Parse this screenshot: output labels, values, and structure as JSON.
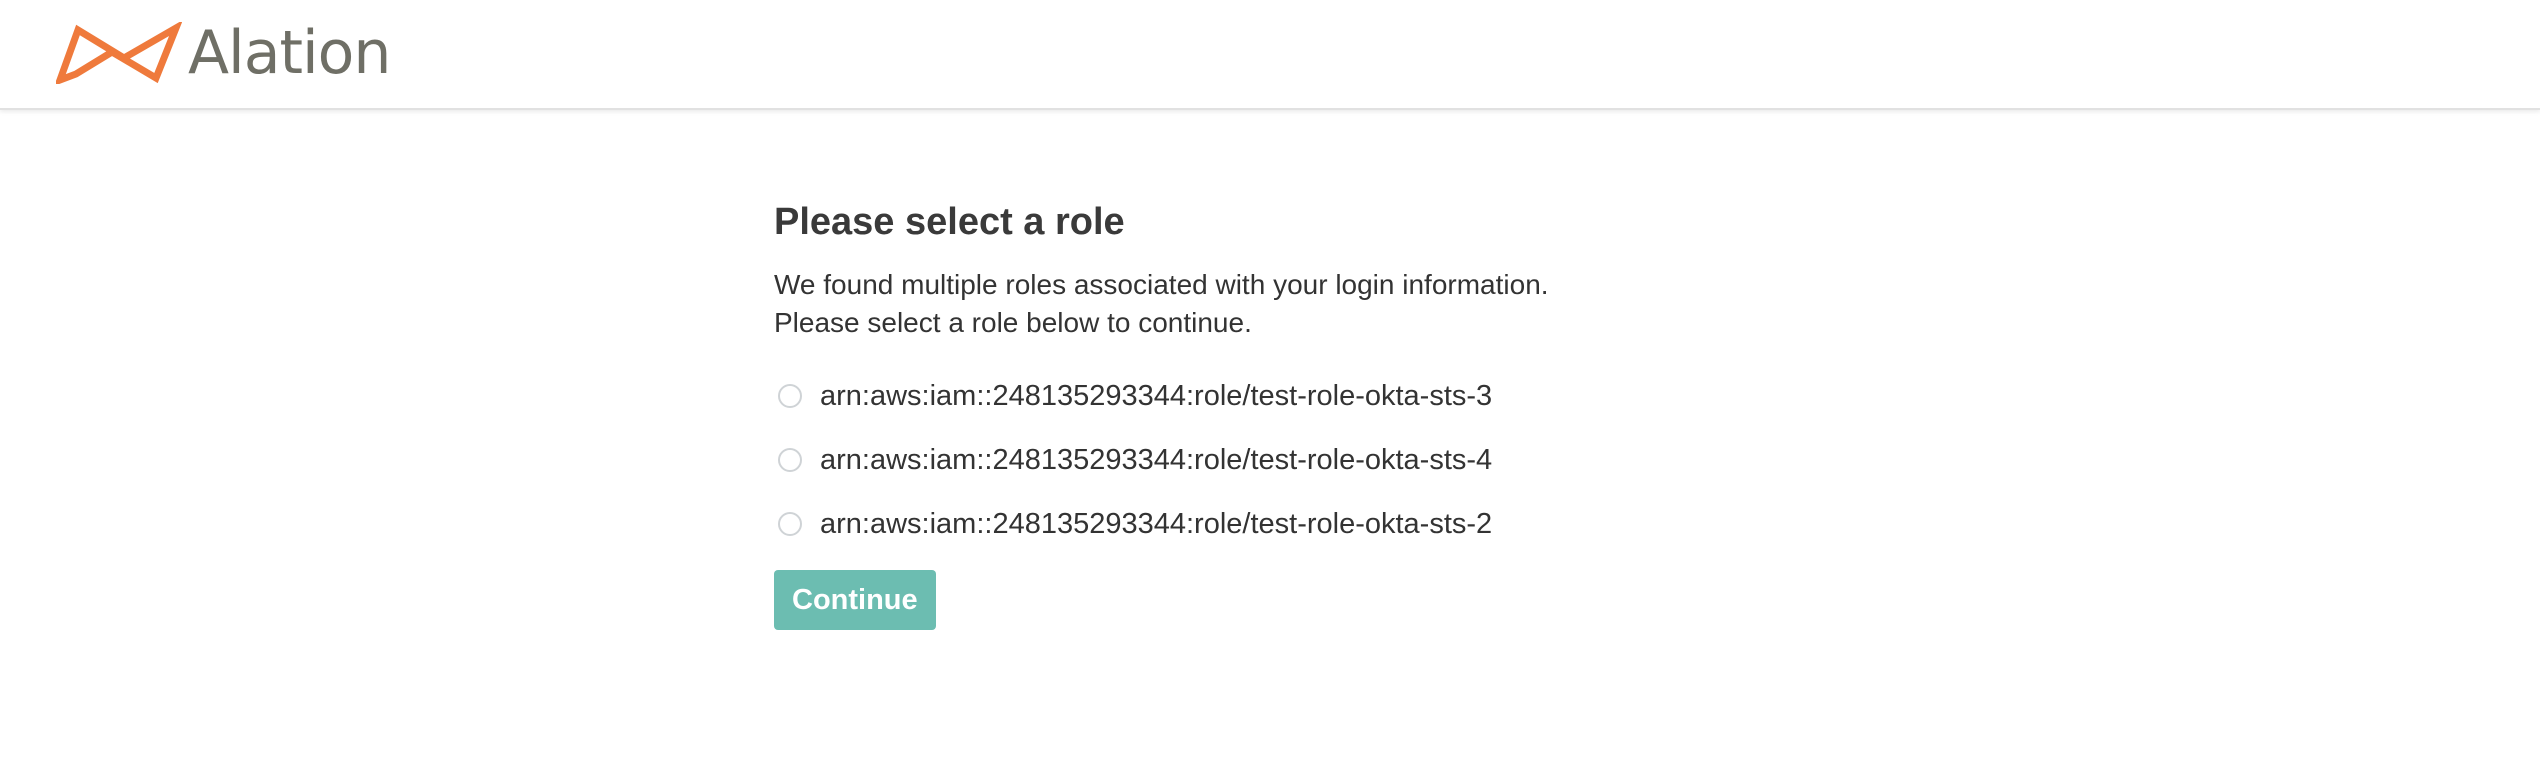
{
  "header": {
    "logo_text": "Alation",
    "logo_icon": "alation-bowtie-logo-icon",
    "logo_color": "#ef7a3c"
  },
  "main": {
    "title": "Please select a role",
    "description_line1": "We found multiple roles associated with your login information.",
    "description_line2": "Please select a role below to continue.",
    "roles": [
      {
        "label": "arn:aws:iam::248135293344:role/test-role-okta-sts-3",
        "selected": false
      },
      {
        "label": "arn:aws:iam::248135293344:role/test-role-okta-sts-4",
        "selected": false
      },
      {
        "label": "arn:aws:iam::248135293344:role/test-role-okta-sts-2",
        "selected": false
      }
    ],
    "continue_label": "Continue",
    "accent_color": "#6cbdb1"
  }
}
